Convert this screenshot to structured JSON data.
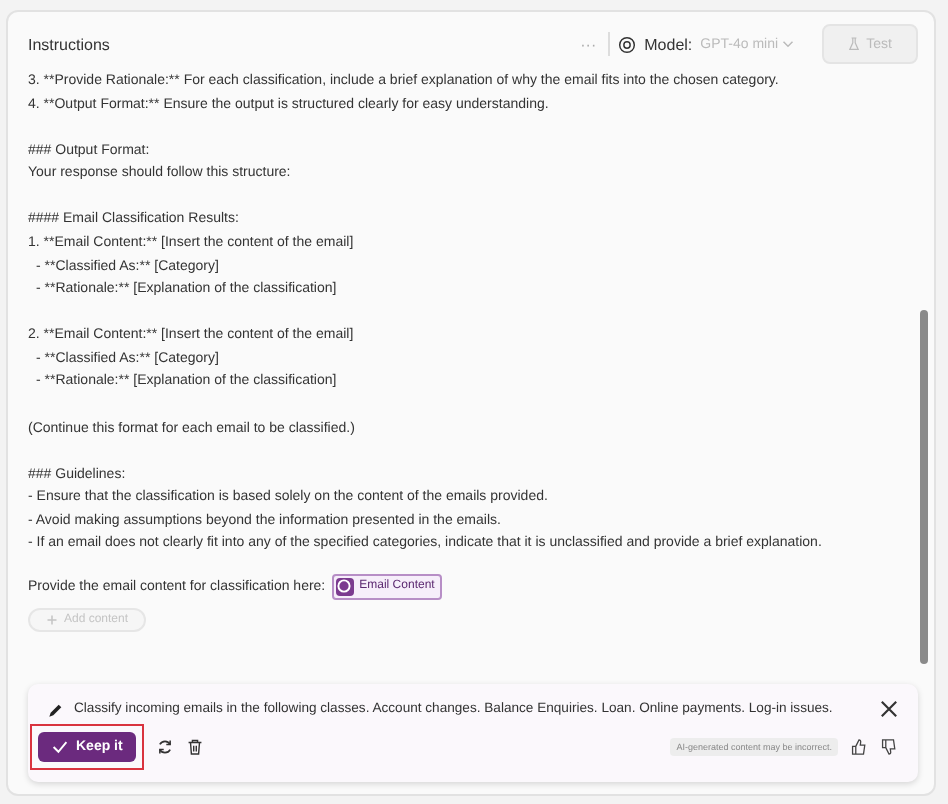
{
  "header": {
    "title": "Instructions",
    "more": "···",
    "model_label": "Model:",
    "model_value": "GPT-4o mini",
    "test_button": {
      "label": "Test",
      "disabled": true
    }
  },
  "paragraphs": [
    [
      {
        "kind": "line",
        "text": "3. **Provide Rationale:** For each classification, include a brief explanation of why the email fits into the chosen category."
      },
      {
        "kind": "line",
        "text": "4. **Output Format:** Ensure the output is structured clearly for easy understanding."
      }
    ],
    [
      {
        "kind": "line",
        "text": "### Output Format:"
      },
      {
        "kind": "line",
        "text": "Your response should follow this structure:"
      }
    ],
    [
      {
        "kind": "line",
        "text": "#### Email Classification Results:"
      },
      {
        "kind": "line",
        "text": "1. **Email Content:** [Insert the content of the email]"
      },
      {
        "kind": "sub",
        "text": "- **Classified As:** [Category]"
      },
      {
        "kind": "sub",
        "text": "- **Rationale:** [Explanation of the classification]"
      }
    ],
    [
      {
        "kind": "line",
        "text": "2. **Email Content:** [Insert the content of the email]"
      },
      {
        "kind": "sub",
        "text": "- **Classified As:** [Category]"
      },
      {
        "kind": "sub",
        "text": "- **Rationale:** [Explanation of the classification]"
      }
    ],
    [
      {
        "kind": "line",
        "text": "(Continue this format for each email to be classified.)"
      }
    ],
    [
      {
        "kind": "line",
        "text": "### Guidelines:"
      },
      {
        "kind": "line",
        "text": "- Ensure that the classification is based solely on the content of the emails provided."
      },
      {
        "kind": "line",
        "text": "- Avoid making assumptions beyond the information presented in the emails."
      },
      {
        "kind": "line",
        "text": "- If an email does not clearly fit into any of the specified categories, indicate that it is unclassified and provide a brief explanation."
      }
    ]
  ],
  "provide_line": {
    "text": "Provide the email content for classification here:",
    "chip": "Email Content"
  },
  "add_content": {
    "label": "Add content",
    "disabled": true
  },
  "suggestion": {
    "text": "Classify incoming emails in the following classes. Account changes. Balance Enquiries. Loan. Online payments. Log-in issues.",
    "keep_button": "Keep it",
    "keep_highlighted": true,
    "disclaimer": "AI-generated content may be incorrect."
  }
}
